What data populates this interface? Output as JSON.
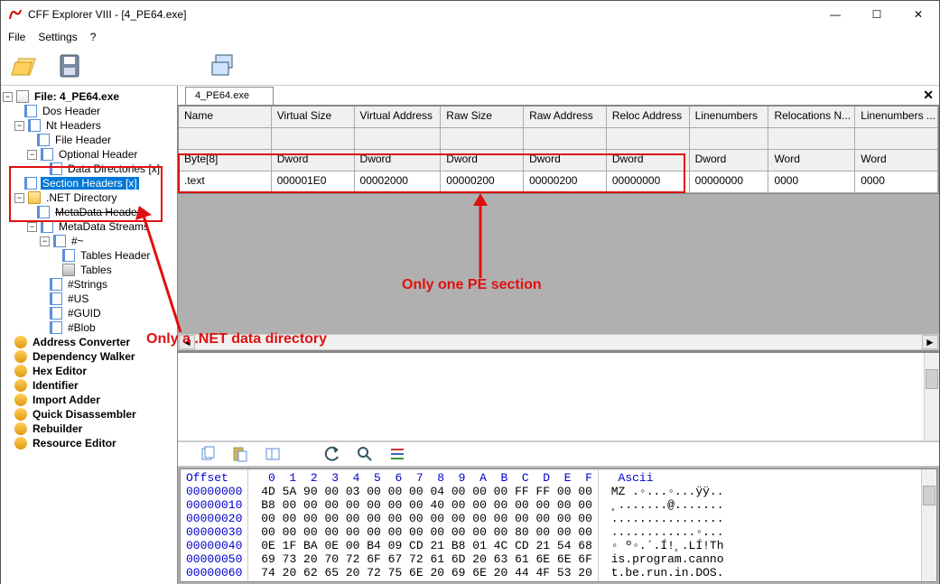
{
  "window": {
    "title": "CFF Explorer VIII - [4_PE64.exe]",
    "min": "—",
    "max": "☐",
    "close": "✕"
  },
  "menu": {
    "file": "File",
    "settings": "Settings",
    "help": "?"
  },
  "tree": {
    "root": "File: 4_PE64.exe",
    "dos": "Dos Header",
    "nt": "Nt Headers",
    "fileh": "File Header",
    "opt": "Optional Header",
    "datadir": "Data Directories [x]",
    "sect": "Section Headers [x]",
    "net": ".NET Directory",
    "meta_h": "MetaData Header",
    "meta_s": "MetaData Streams",
    "htilde": "#~",
    "tblh": "Tables Header",
    "tbls": "Tables",
    "strings": "#Strings",
    "us": "#US",
    "guid": "#GUID",
    "blob": "#Blob",
    "addr": "Address Converter",
    "dep": "Dependency Walker",
    "hex": "Hex Editor",
    "ident": "Identifier",
    "imp": "Import Adder",
    "quick": "Quick Disassembler",
    "reb": "Rebuilder",
    "res": "Resource Editor"
  },
  "tab": {
    "label": "4_PE64.exe"
  },
  "grid": {
    "headers": [
      "Name",
      "Virtual Size",
      "Virtual Address",
      "Raw Size",
      "Raw Address",
      "Reloc Address",
      "Linenumbers",
      "Relocations N...",
      "Linenumbers ..."
    ],
    "types": [
      "Byte[8]",
      "Dword",
      "Dword",
      "Dword",
      "Dword",
      "Dword",
      "Dword",
      "Word",
      "Word"
    ],
    "row": [
      ".text",
      "000001E0",
      "00002000",
      "00000200",
      "00000200",
      "00000000",
      "00000000",
      "0000",
      "0000"
    ]
  },
  "annot": {
    "sec": "Only one PE section",
    "net": "Only a .NET data directory"
  },
  "hex": {
    "hdr_off": "Offset  ",
    "hdr_b": "0  1  2  3  4  5  6  7  8  9  A  B  C  D  E  F",
    "hdr_a": "Ascii",
    "rows": [
      {
        "o": "00000000",
        "b": "4D 5A 90 00 03 00 00 00 04 00 00 00 FF FF 00 00",
        "a": "MZ .◦...◦...ÿÿ.."
      },
      {
        "o": "00000010",
        "b": "B8 00 00 00 00 00 00 00 40 00 00 00 00 00 00 00",
        "a": "¸.......@......."
      },
      {
        "o": "00000020",
        "b": "00 00 00 00 00 00 00 00 00 00 00 00 00 00 00 00",
        "a": "................"
      },
      {
        "o": "00000030",
        "b": "00 00 00 00 00 00 00 00 00 00 00 00 80 00 00 00",
        "a": "............◦..."
      },
      {
        "o": "00000040",
        "b": "0E 1F BA 0E 00 B4 09 CD 21 B8 01 4C CD 21 54 68",
        "a": "◦ º◦.´.Í!¸.LÍ!Th"
      },
      {
        "o": "00000050",
        "b": "69 73 20 70 72 6F 67 72 61 6D 20 63 61 6E 6E 6F",
        "a": "is.program.canno"
      },
      {
        "o": "00000060",
        "b": "74 20 62 65 20 72 75 6E 20 69 6E 20 44 4F 53 20",
        "a": "t.be.run.in.DOS."
      }
    ]
  }
}
